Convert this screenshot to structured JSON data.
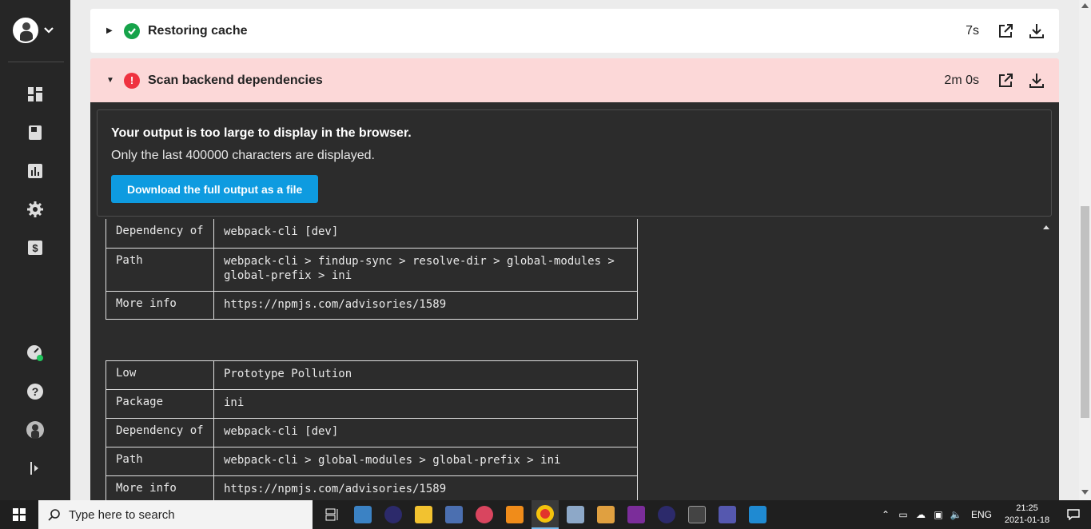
{
  "steps": [
    {
      "title": "Restoring cache",
      "duration": "7s",
      "status": "success"
    },
    {
      "title": "Scan backend dependencies",
      "duration": "2m 0s",
      "status": "failed"
    }
  ],
  "notice": {
    "heading": "Your output is too large to display in the browser.",
    "text": "Only the last 400000 characters are displayed.",
    "button": "Download the full output as a file"
  },
  "log": {
    "table1": [
      {
        "key": "Dependency of",
        "value": "webpack-cli [dev]"
      },
      {
        "key": "Path",
        "value": "webpack-cli > findup-sync > resolve-dir > global-modules >",
        "value2": "global-prefix > ini"
      },
      {
        "key": "More info",
        "value": "https://npmjs.com/advisories/1589"
      }
    ],
    "table2": [
      {
        "key": "Low",
        "value": "Prototype Pollution"
      },
      {
        "key": "Package",
        "value": "ini"
      },
      {
        "key": "Dependency of",
        "value": "webpack-cli [dev]"
      },
      {
        "key": "Path",
        "value": "webpack-cli > global-modules > global-prefix > ini"
      },
      {
        "key": "More info",
        "value": "https://npmjs.com/advisories/1589"
      }
    ]
  },
  "taskbar": {
    "search_placeholder": "Type here to search",
    "language": "ENG",
    "time": "21:25",
    "date": "2021-01-18"
  },
  "colors": {
    "success": "#16a34a",
    "failed": "#ef3340",
    "button": "#0e9be0",
    "sidebar": "#262626",
    "log_bg": "#2c2c2c"
  }
}
